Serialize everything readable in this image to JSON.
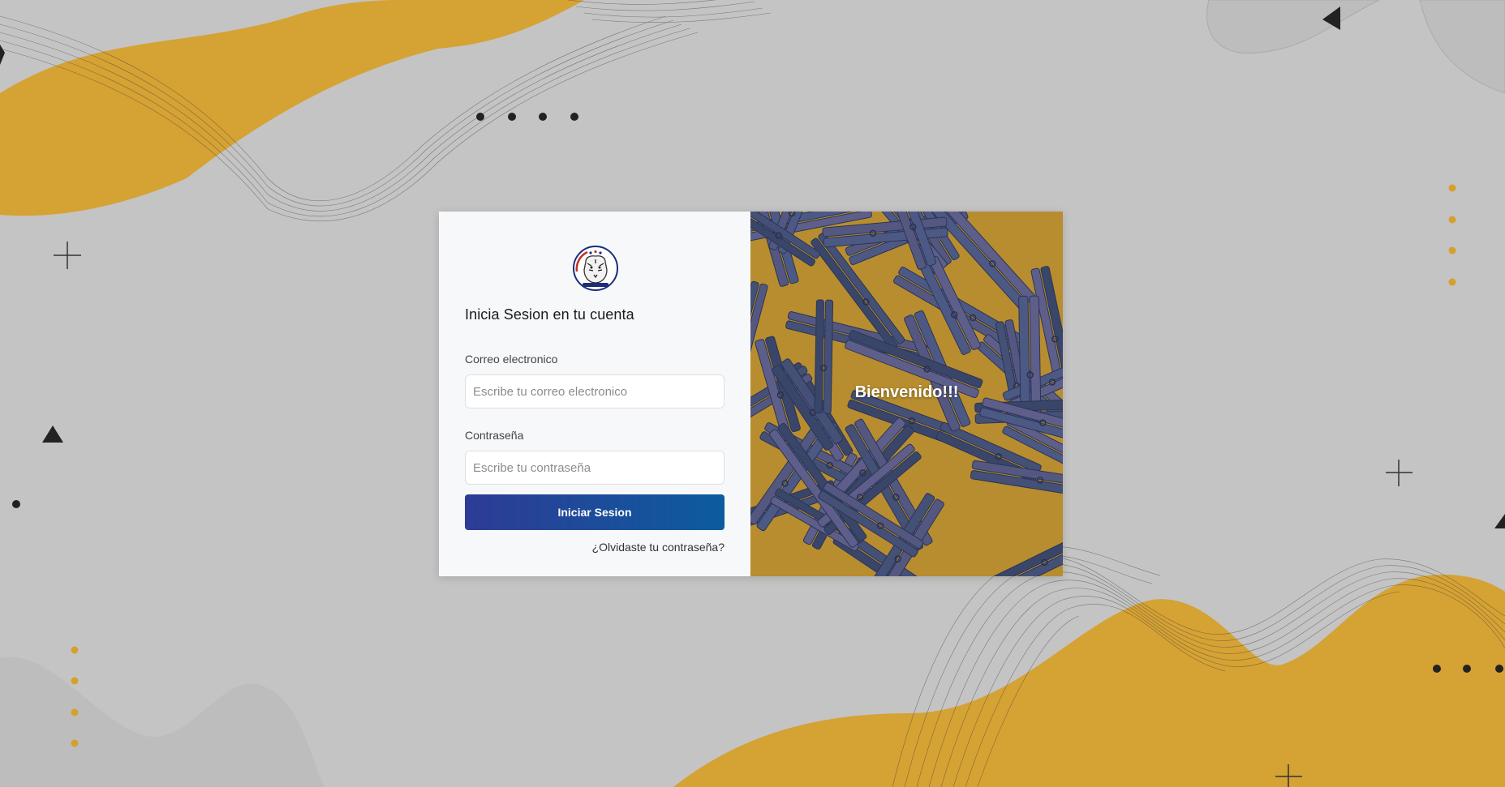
{
  "login": {
    "title": "Inicia Sesion en tu cuenta",
    "email_label": "Correo electronico",
    "email_placeholder": "Escribe tu correo electronico",
    "password_label": "Contraseña",
    "password_placeholder": "Escribe tu contraseña",
    "submit_label": "Iniciar Sesion",
    "forgot_label": "¿Olvidaste tu contraseña?"
  },
  "hero": {
    "welcome_text": "Bienvenido!!!"
  },
  "logo": {
    "icon": "tiger-emblem-icon"
  },
  "colors": {
    "background": "#c4c4c4",
    "accent_gold": "#d79f22",
    "button_start": "#2e3b96",
    "button_end": "#0c5c9f"
  }
}
